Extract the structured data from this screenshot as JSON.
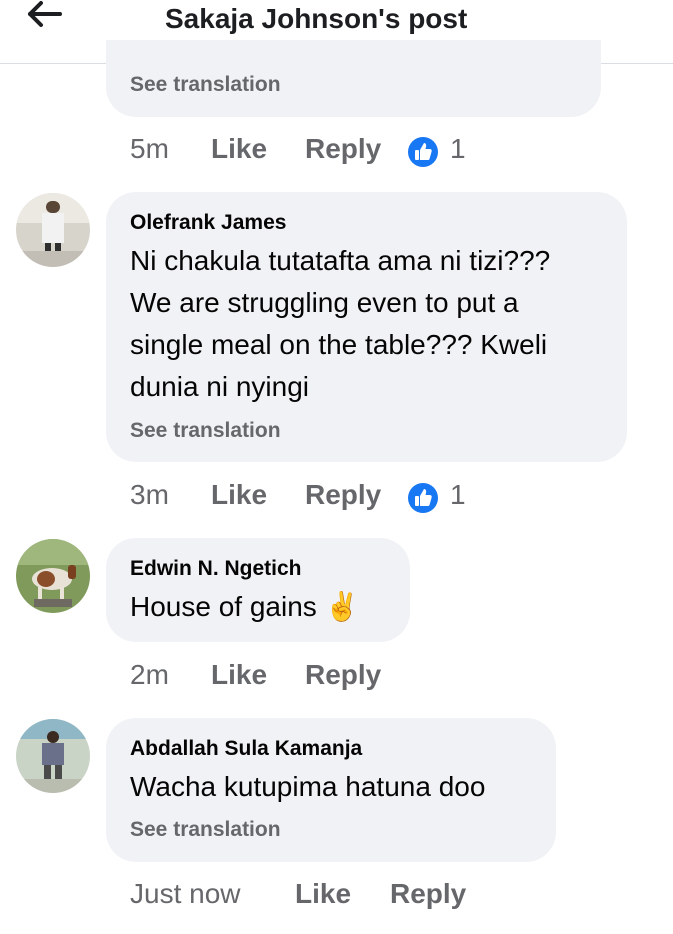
{
  "header": {
    "title": "Sakaja Johnson's post"
  },
  "comments": [
    {
      "see_translation": "See translation",
      "time": "5m",
      "like": "Like",
      "reply": "Reply",
      "reactions": "1"
    },
    {
      "author": "Olefrank James",
      "lines": [
        "Ni chakula tutatafta ama ni tizi???",
        "We are struggling even to put a",
        "single meal on the table??? Kweli",
        "dunia ni nyingi"
      ],
      "see_translation": "See translation",
      "time": "3m",
      "like": "Like",
      "reply": "Reply",
      "reactions": "1"
    },
    {
      "author": "Edwin N. Ngetich",
      "text": "House of gains",
      "emoji": "✌",
      "time": "2m",
      "like": "Like",
      "reply": "Reply"
    },
    {
      "author": "Abdallah Sula Kamanja",
      "text": "Wacha kutupima hatuna doo",
      "see_translation": "See translation",
      "time": "Just now",
      "like": "Like",
      "reply": "Reply"
    }
  ],
  "colors": {
    "like_blue": "#1877f2",
    "bubble": "#f0f2f5",
    "meta": "#65676b"
  },
  "icons": {
    "back": "back-arrow-icon",
    "like": "thumbs-up-icon"
  }
}
